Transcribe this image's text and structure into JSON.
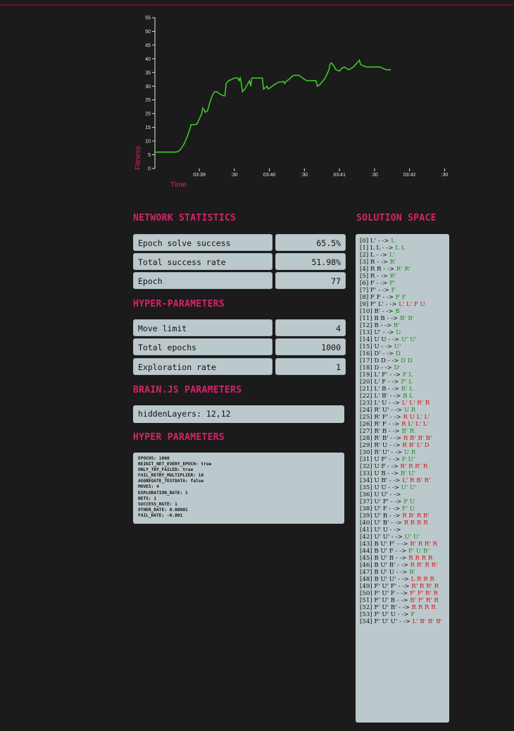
{
  "colors": {
    "background": "#1c1b1c",
    "accent": "#d5246a",
    "panel": "#bcc9cc",
    "line": "#3fd12b",
    "success_move": "#1d8a1d",
    "failed_move": "#d41010"
  },
  "chart_data": {
    "type": "line",
    "xlabel": "Time",
    "ylabel": "Fitness",
    "ylim": [
      0,
      55
    ],
    "yticks": [
      "0",
      "5",
      "10",
      "15",
      "20",
      "25",
      "30",
      "35",
      "40",
      "45",
      "50",
      "55"
    ],
    "xticks": [
      {
        "label": "03:39",
        "t": 16
      },
      {
        "label": ":30",
        "t": 46
      },
      {
        "label": "03:40",
        "t": 76
      },
      {
        "label": ":30",
        "t": 106
      },
      {
        "label": "03:41",
        "t": 136
      },
      {
        "label": ":30",
        "t": 166
      },
      {
        "label": "03:42",
        "t": 196
      },
      {
        "label": ":30",
        "t": 226
      }
    ],
    "xlim": [
      -22,
      236
    ],
    "grid": false,
    "series": [
      {
        "values": [
          [
            -22,
            6
          ],
          [
            -4,
            6
          ],
          [
            -2,
            6.2
          ],
          [
            0,
            7
          ],
          [
            3,
            9
          ],
          [
            6,
            12
          ],
          [
            8,
            14.5
          ],
          [
            9,
            16
          ],
          [
            12,
            16
          ],
          [
            14,
            16.2
          ],
          [
            16,
            18
          ],
          [
            18,
            20
          ],
          [
            19,
            22
          ],
          [
            20,
            21.5
          ],
          [
            21,
            20.5
          ],
          [
            23,
            21
          ],
          [
            25,
            24
          ],
          [
            27,
            26.5
          ],
          [
            29,
            28
          ],
          [
            31,
            28
          ],
          [
            34,
            27
          ],
          [
            37,
            26.5
          ],
          [
            38,
            26.5
          ],
          [
            39,
            31
          ],
          [
            41,
            32
          ],
          [
            44,
            32.5
          ],
          [
            46,
            33
          ],
          [
            49,
            33
          ],
          [
            50,
            32
          ],
          [
            51,
            33
          ],
          [
            52,
            31
          ],
          [
            53,
            28
          ],
          [
            55,
            29
          ],
          [
            57,
            30.5
          ],
          [
            59,
            32
          ],
          [
            60,
            30
          ],
          [
            61,
            33
          ],
          [
            63,
            33
          ],
          [
            67,
            33
          ],
          [
            70,
            33
          ],
          [
            71,
            29
          ],
          [
            73,
            29.5
          ],
          [
            74,
            30
          ],
          [
            75,
            29
          ],
          [
            77,
            29.5
          ],
          [
            80,
            30.5
          ],
          [
            82,
            31
          ],
          [
            84,
            31.5
          ],
          [
            86,
            31.5
          ],
          [
            88,
            31.8
          ],
          [
            89,
            31
          ],
          [
            91,
            32
          ],
          [
            93,
            32.5
          ],
          [
            95,
            33.5
          ],
          [
            97,
            34
          ],
          [
            100,
            34
          ],
          [
            101,
            34
          ],
          [
            103,
            33.5
          ],
          [
            106,
            32.5
          ],
          [
            108,
            32
          ],
          [
            110,
            32
          ],
          [
            112,
            32
          ],
          [
            114,
            32
          ],
          [
            116,
            32
          ],
          [
            117,
            30
          ],
          [
            119,
            30.5
          ],
          [
            121,
            31.5
          ],
          [
            123,
            32.5
          ],
          [
            125,
            34
          ],
          [
            127,
            36
          ],
          [
            128,
            38
          ],
          [
            129,
            38.5
          ],
          [
            131,
            37.5
          ],
          [
            133,
            36
          ],
          [
            136,
            35.5
          ],
          [
            138,
            36.5
          ],
          [
            140,
            37
          ],
          [
            142,
            36.5
          ],
          [
            144,
            36
          ],
          [
            146,
            36.5
          ],
          [
            148,
            37
          ],
          [
            150,
            38
          ],
          [
            152,
            39
          ],
          [
            153,
            39.5
          ],
          [
            154,
            38
          ],
          [
            156,
            37.5
          ],
          [
            159,
            37
          ],
          [
            163,
            37
          ],
          [
            167,
            37
          ],
          [
            171,
            37
          ],
          [
            173,
            36.5
          ],
          [
            176,
            36
          ],
          [
            180,
            36
          ]
        ]
      }
    ]
  },
  "network_statistics": {
    "title": "NETWORK STATISTICS",
    "rows": [
      {
        "label": "Epoch solve success",
        "value": "65.5%"
      },
      {
        "label": "Total success rate",
        "value": "51.98%"
      },
      {
        "label": "Epoch",
        "value": "77"
      }
    ]
  },
  "hyper_parameters": {
    "title": "HYPER-PARAMETERS",
    "rows": [
      {
        "label": "Move limit",
        "value": "4"
      },
      {
        "label": "Total epochs",
        "value": "1000"
      },
      {
        "label": "Exploration rate",
        "value": "1"
      }
    ]
  },
  "brainjs": {
    "title": "BRAIN.JS PARAMETERS",
    "value": "hiddenLayers: 12,12"
  },
  "hyper_parameters_raw": {
    "title": "HYPER PARAMETERS",
    "lines": [
      "EPOCHS: 1000",
      "REINIT_NET_EVERY_EPOCH: true",
      "ONLY_TRY_FAILED: true",
      "FAIL_RETRY_MULTIPLIER: 10",
      "AGGREGATE_TESTDATA: false",
      "MOVES: 4",
      "EXPLORATION_RATE: 1",
      "NETS: 1",
      "SUCCESS_RATE: 1",
      "OTHER_RATE: 0.00001",
      "FAIL_RATE: -0.001"
    ]
  },
  "solution_space": {
    "title": "SOLUTION SPACE",
    "items": [
      {
        "scramble": "[0] L' - ->",
        "solution": "L",
        "ok": true
      },
      {
        "scramble": "[1] L L - ->",
        "solution": "L L",
        "ok": true
      },
      {
        "scramble": "[2] L - ->",
        "solution": "L'",
        "ok": true
      },
      {
        "scramble": "[3] R - ->",
        "solution": "R'",
        "ok": true
      },
      {
        "scramble": "[4] R R - ->",
        "solution": "R' R'",
        "ok": true
      },
      {
        "scramble": "[5] R - ->",
        "solution": "R'",
        "ok": true
      },
      {
        "scramble": "[6] F - ->",
        "solution": "F'",
        "ok": true
      },
      {
        "scramble": "[7] F' - ->",
        "solution": "F",
        "ok": true
      },
      {
        "scramble": "[8] F F - ->",
        "solution": "F F",
        "ok": true
      },
      {
        "scramble": "[9] F' L' - ->",
        "solution": "L' L' F U",
        "ok": false
      },
      {
        "scramble": "[10] B' - ->",
        "solution": "B",
        "ok": true
      },
      {
        "scramble": "[11] B B - ->",
        "solution": "B' B'",
        "ok": true
      },
      {
        "scramble": "[12] B - ->",
        "solution": "B'",
        "ok": true
      },
      {
        "scramble": "[13] U' - ->",
        "solution": "U",
        "ok": true
      },
      {
        "scramble": "[14] U U - ->",
        "solution": "U' U'",
        "ok": true
      },
      {
        "scramble": "[15] U - ->",
        "solution": "U'",
        "ok": true
      },
      {
        "scramble": "[16] D' - ->",
        "solution": "D",
        "ok": true
      },
      {
        "scramble": "[17] D D - ->",
        "solution": "D D",
        "ok": true
      },
      {
        "scramble": "[18] D - ->",
        "solution": "D'",
        "ok": true
      },
      {
        "scramble": "[19] L' F' - ->",
        "solution": "F L",
        "ok": true
      },
      {
        "scramble": "[20] L' F - ->",
        "solution": "F' L",
        "ok": true
      },
      {
        "scramble": "[21] L' B - ->",
        "solution": "B' L",
        "ok": true
      },
      {
        "scramble": "[22] L' B' - ->",
        "solution": "B L",
        "ok": true
      },
      {
        "scramble": "[23] L' U - ->",
        "solution": "L' L' R' R",
        "ok": false
      },
      {
        "scramble": "[24] R' U' - ->",
        "solution": "U R",
        "ok": true
      },
      {
        "scramble": "[25] R' F' - ->",
        "solution": "R U L' L'",
        "ok": false
      },
      {
        "scramble": "[26] R' F - ->",
        "solution": "R L' L' L'",
        "ok": false
      },
      {
        "scramble": "[27] R' B - ->",
        "solution": "B' R",
        "ok": true
      },
      {
        "scramble": "[28] R' B' - ->",
        "solution": "R B' B' B'",
        "ok": false
      },
      {
        "scramble": "[29] R' U - ->",
        "solution": "R B' L' D",
        "ok": false
      },
      {
        "scramble": "[30] R' U' - ->",
        "solution": "U R",
        "ok": true
      },
      {
        "scramble": "[31] U F' - ->",
        "solution": "F U'",
        "ok": true
      },
      {
        "scramble": "[32] U F - ->",
        "solution": "R' R R' R",
        "ok": false
      },
      {
        "scramble": "[33] U B - ->",
        "solution": "B' U'",
        "ok": true
      },
      {
        "scramble": "[34] U B' - ->",
        "solution": "L' R B' R'",
        "ok": false
      },
      {
        "scramble": "[35] U U - ->",
        "solution": "U' U'",
        "ok": true
      },
      {
        "scramble": "[36] U U' - ->",
        "solution": "",
        "ok": true
      },
      {
        "scramble": "[37] U' F' - ->",
        "solution": "F U",
        "ok": true
      },
      {
        "scramble": "[38] U' F - ->",
        "solution": "F' U",
        "ok": true
      },
      {
        "scramble": "[39] U' B - ->",
        "solution": "R B' R R'",
        "ok": false
      },
      {
        "scramble": "[40] U' B' - ->",
        "solution": "R R R R",
        "ok": false
      },
      {
        "scramble": "[41] U' U - ->",
        "solution": "",
        "ok": true
      },
      {
        "scramble": "[42] U' U' - ->",
        "solution": "U' U'",
        "ok": true
      },
      {
        "scramble": "[43] B U' F' - ->",
        "solution": "B' R R' R",
        "ok": false
      },
      {
        "scramble": "[44] B U' F - ->",
        "solution": "F' U B'",
        "ok": true
      },
      {
        "scramble": "[45] B U' B - ->",
        "solution": "R R R R",
        "ok": false
      },
      {
        "scramble": "[46] B U' B' - ->",
        "solution": "R R' R R'",
        "ok": false
      },
      {
        "scramble": "[47] B U' U - ->",
        "solution": "B'",
        "ok": true
      },
      {
        "scramble": "[48] B U' U' - ->",
        "solution": "L R R R",
        "ok": false
      },
      {
        "scramble": "[49] F' U' F' - ->",
        "solution": "R' R R' R",
        "ok": false
      },
      {
        "scramble": "[50] F' U' F - ->",
        "solution": "F' F' R' R",
        "ok": false
      },
      {
        "scramble": "[51] F' U' B - ->",
        "solution": "B' F' R' R",
        "ok": false
      },
      {
        "scramble": "[52] F' U' B' - ->",
        "solution": "R R R R",
        "ok": false
      },
      {
        "scramble": "[53] F' U' U - ->",
        "solution": "F",
        "ok": true
      },
      {
        "scramble": "[54] F' U' U' - ->",
        "solution": "L' B' B' B'",
        "ok": false
      }
    ]
  }
}
